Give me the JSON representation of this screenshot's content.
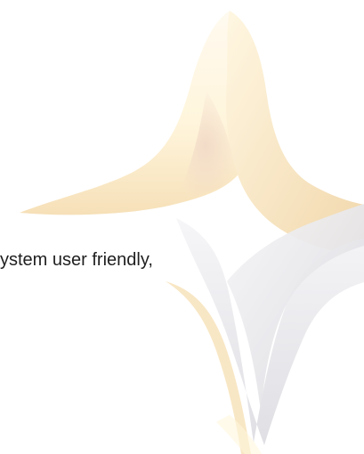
{
  "fragment": {
    "text": "ystem user friendly,"
  },
  "decorative": {
    "icon": "star-sparkle-icon",
    "colors": {
      "gold_light": "#fff6dc",
      "gold_mid": "#f7e4bf",
      "gold_shadow": "#ead6c4",
      "gray_light": "#f3f3f5",
      "gray_mid": "#e3e3e7",
      "gray_shadow": "#d7d7dc",
      "background": "#ffffff"
    }
  }
}
